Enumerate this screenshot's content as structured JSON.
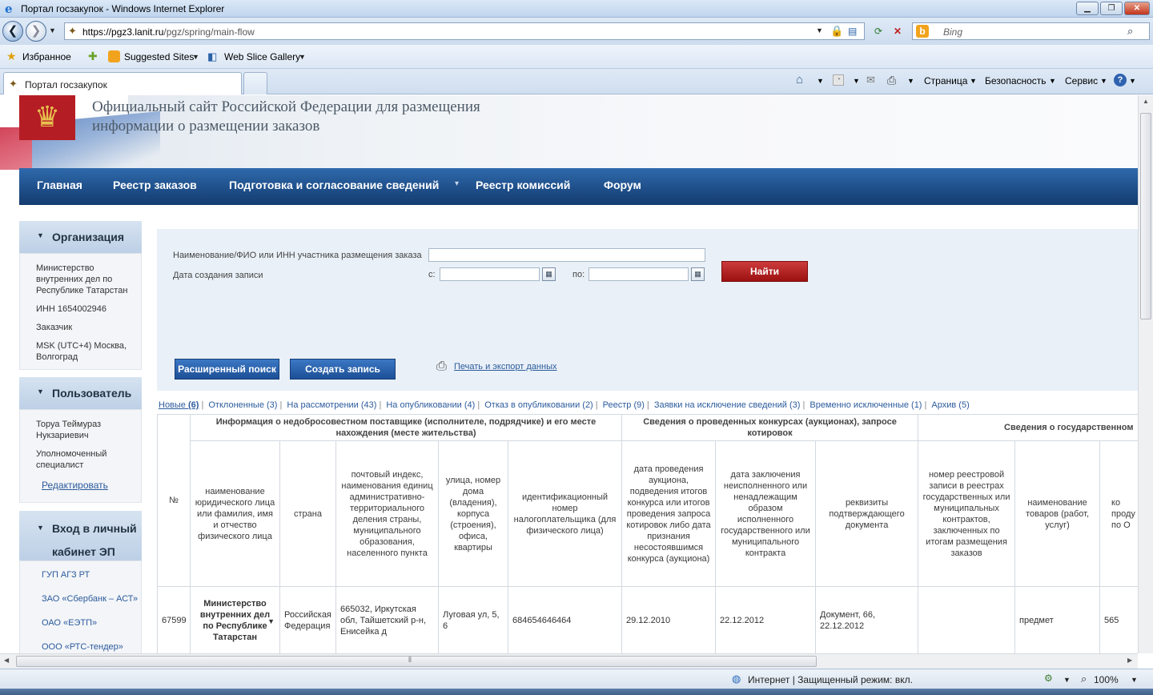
{
  "window": {
    "title": "Портал госзакупок - Windows Internet Explorer",
    "controls": {
      "minimize": "▁",
      "maximize": "❐",
      "close": "✕"
    }
  },
  "address_bar": {
    "url_prefix": "https://",
    "url_host": "pgz3.lanit.ru",
    "url_path": "/pgz/spring/main-flow",
    "search_placeholder": "Bing"
  },
  "favorites_bar": {
    "favorites_label": "Избранное",
    "suggested_sites": "Suggested Sites",
    "web_slice_gallery": "Web Slice Gallery"
  },
  "tab": {
    "title": "Портал госзакупок"
  },
  "command_bar": {
    "page": "Страница",
    "security": "Безопасность",
    "service": "Сервис"
  },
  "site": {
    "title": "Официальный сайт Российской Федерации для размещения информации о размещении заказов",
    "nav": [
      {
        "label": "Главная"
      },
      {
        "label": "Реестр заказов"
      },
      {
        "label": "Подготовка и согласование сведений"
      },
      {
        "label": "Реестр комиссий"
      },
      {
        "label": "Форум"
      }
    ]
  },
  "sidebar": {
    "organization": {
      "heading": "Организация",
      "name": "Министерство внутренних дел по Республике Татарстан",
      "inn": "ИНН 1654002946",
      "role": "Заказчик",
      "timezone": "MSK (UTC+4) Москва, Волгоград"
    },
    "user": {
      "heading": "Пользователь",
      "name": "Торуа Теймураз Нукзариевич",
      "role": "Уполномоченный специалист",
      "edit_link": "Редактировать"
    },
    "ep_login": {
      "heading": "Вход в личный кабинет ЭП",
      "links": [
        "ГУП АГЗ РТ",
        "ЗАО «Сбербанк – АСТ»",
        "ОАО «ЕЭТП»",
        "ООО «РТС-тендер»"
      ]
    }
  },
  "filter": {
    "name_label": "Наименование/ФИО или ИНН участника размещения заказа",
    "name_value": "",
    "date_label": "Дата создания записи",
    "from_label": "с:",
    "to_label": "по:",
    "from_value": "",
    "to_value": "",
    "find_button": "Найти",
    "advanced_search_button": "Расширенный поиск",
    "create_record_button": "Создать запись",
    "print_export_link": "Печать и экспорт данных"
  },
  "status_tabs": [
    {
      "label": "Новые",
      "count": "(6)"
    },
    {
      "label": "Отклоненные",
      "count": "(3)"
    },
    {
      "label": "На рассмотрении",
      "count": "(43)"
    },
    {
      "label": "На опубликовании",
      "count": "(4)"
    },
    {
      "label": "Отказ в опубликовании",
      "count": "(2)"
    },
    {
      "label": "Реестр",
      "count": "(9)"
    },
    {
      "label": "Заявки на исключение сведений",
      "count": "(3)"
    },
    {
      "label": "Временно исключенные",
      "count": "(1)"
    },
    {
      "label": "Архив",
      "count": "(5)"
    }
  ],
  "table": {
    "group_headers": [
      "Информация о недобросовестном поставщике (исполнителе, подрядчике) и его месте нахождения (месте жительства)",
      "Сведения о проведенных конкурсах (аукционах), запросе котировок",
      "Сведения о государственном"
    ],
    "num_header": "№",
    "columns": [
      "наименование юридического лица или фамилия, имя и отчество физического лица",
      "страна",
      "почтовый индекс, наименования единиц административно-территориального деления страны, муниципального образования, населенного пункта",
      "улица, номер дома (владения), корпуса (строения), офиса, квартиры",
      "идентификационный номер налогоплательщика (для физического лица)",
      "дата проведения аукциона, подведения итогов конкурса или итогов проведения запроса котировок либо дата признания несостоявшимся конкурса (аукциона)",
      "дата заключения неисполненного или ненадлежащим образом исполненного государственного или муниципального контракта",
      "реквизиты подтверждающего документа",
      "номер реестровой записи в реестрах государственных или муниципальных контрактов, заключенных по итогам размещения заказов",
      "наименование товаров (работ, услуг)",
      "ко\nпроду\nпо О"
    ],
    "rows": [
      {
        "num": "67599",
        "name": "Министерство внутренних дел по Республике Татарстан",
        "country": "Российская Федерация",
        "postal": "665032, Иркутская обл, Тайшетский р-н, Енисейка д",
        "street": "Луговая ул, 5, 6",
        "inn": "684654646464",
        "auction_date": "29.12.2010",
        "contract_date": "22.12.2012",
        "document": "Документ, 66, 22.12.2012",
        "registry_no": "",
        "goods": "предмет",
        "code": "565"
      }
    ]
  },
  "status_bar": {
    "zone": "Интернет | Защищенный режим: вкл.",
    "zoom": "100%"
  }
}
